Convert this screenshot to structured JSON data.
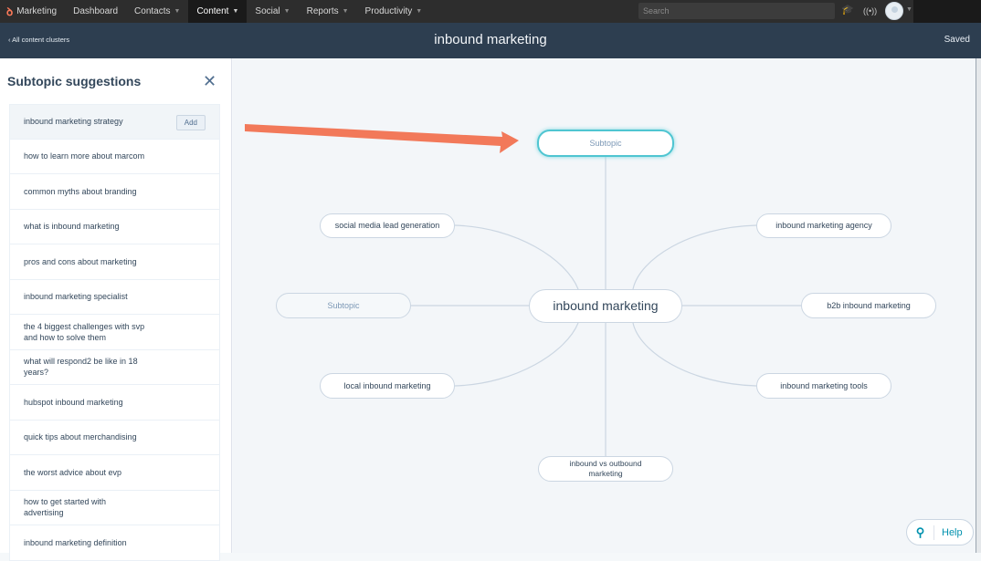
{
  "topnav": {
    "brand": "Marketing",
    "items": [
      {
        "label": "Dashboard",
        "has_caret": false
      },
      {
        "label": "Contacts",
        "has_caret": true
      },
      {
        "label": "Content",
        "has_caret": true,
        "active": true
      },
      {
        "label": "Social",
        "has_caret": true
      },
      {
        "label": "Reports",
        "has_caret": true
      },
      {
        "label": "Productivity",
        "has_caret": true
      }
    ],
    "caret_glyph": "▼",
    "search_placeholder": "Search",
    "icons": {
      "academy": "🎓",
      "notifications": "((•))"
    },
    "avatar_caret": "▼"
  },
  "subheader": {
    "back_link": "‹  All content clusters",
    "title": "inbound marketing",
    "status": "Saved"
  },
  "sidebar": {
    "title": "Subtopic suggestions",
    "close_glyph": "✕",
    "add_label": "Add",
    "suggestions": [
      "inbound marketing strategy",
      "how to learn more about marcom",
      "common myths about branding",
      "what is inbound marketing",
      "pros and cons about marketing",
      "inbound marketing specialist",
      "the 4 biggest challenges with svp and how to solve them",
      "what will respond2 be like in 18 years?",
      "hubspot inbound marketing",
      "quick tips about merchandising",
      "the worst advice about evp",
      "how to get started with advertising",
      "inbound marketing definition"
    ]
  },
  "cluster": {
    "central": "inbound marketing",
    "nodes": {
      "top": "Subtopic",
      "upper_left": "social media lead generation",
      "left": "Subtopic",
      "lower_left": "local inbound marketing",
      "bottom": "inbound vs outbound marketing",
      "upper_right": "inbound marketing agency",
      "right": "b2b inbound marketing",
      "lower_right": "inbound marketing tools"
    },
    "colors": {
      "link": "#cbd6e2",
      "selected_border": "#4fc5d1",
      "annotation_arrow": "#f2795a"
    }
  },
  "help": {
    "search_glyph": "⚲",
    "label": "Help"
  }
}
